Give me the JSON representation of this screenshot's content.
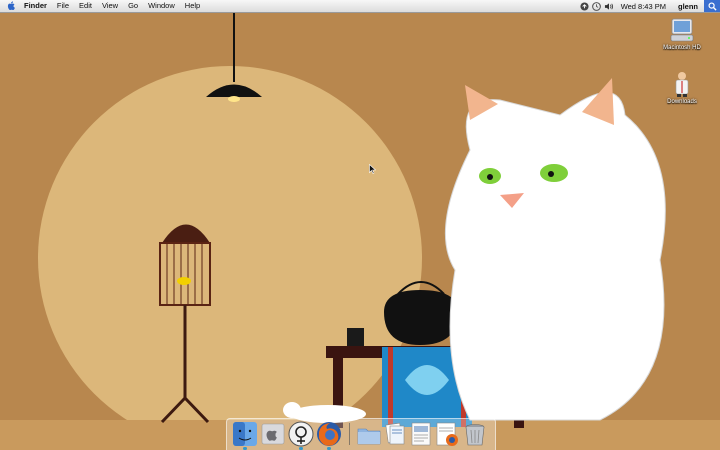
{
  "menubar": {
    "apple_icon": "apple-icon",
    "app_name": "Finder",
    "menus": [
      "File",
      "Edit",
      "View",
      "Go",
      "Window",
      "Help"
    ],
    "clock": "Wed 8:43 PM",
    "user": "glenn"
  },
  "desktop_icons": [
    {
      "label": "Macintosh HD",
      "icon": "hard-drive-icon"
    },
    {
      "label": "Downloads",
      "icon": "downloads-folder-icon"
    }
  ],
  "dock": {
    "items": [
      {
        "name": "finder",
        "icon": "finder-icon",
        "running": true
      },
      {
        "name": "system-preferences",
        "icon": "apple-preferences-icon",
        "running": false
      },
      {
        "name": "adium",
        "icon": "adium-icon",
        "running": true
      },
      {
        "name": "firefox",
        "icon": "firefox-icon",
        "running": true
      },
      {
        "name": "applications-folder",
        "icon": "folder-icon",
        "running": false
      },
      {
        "name": "documents-folder",
        "icon": "documents-folder-icon",
        "running": false
      },
      {
        "name": "document-stack",
        "icon": "document-icon",
        "running": false
      },
      {
        "name": "web-document",
        "icon": "web-document-icon",
        "running": false
      },
      {
        "name": "trash",
        "icon": "trash-icon",
        "running": false
      }
    ]
  },
  "colors": {
    "wallpaper": "#b8874e",
    "moon": "#dcb77a",
    "spotlight": "#3a6fd0"
  }
}
